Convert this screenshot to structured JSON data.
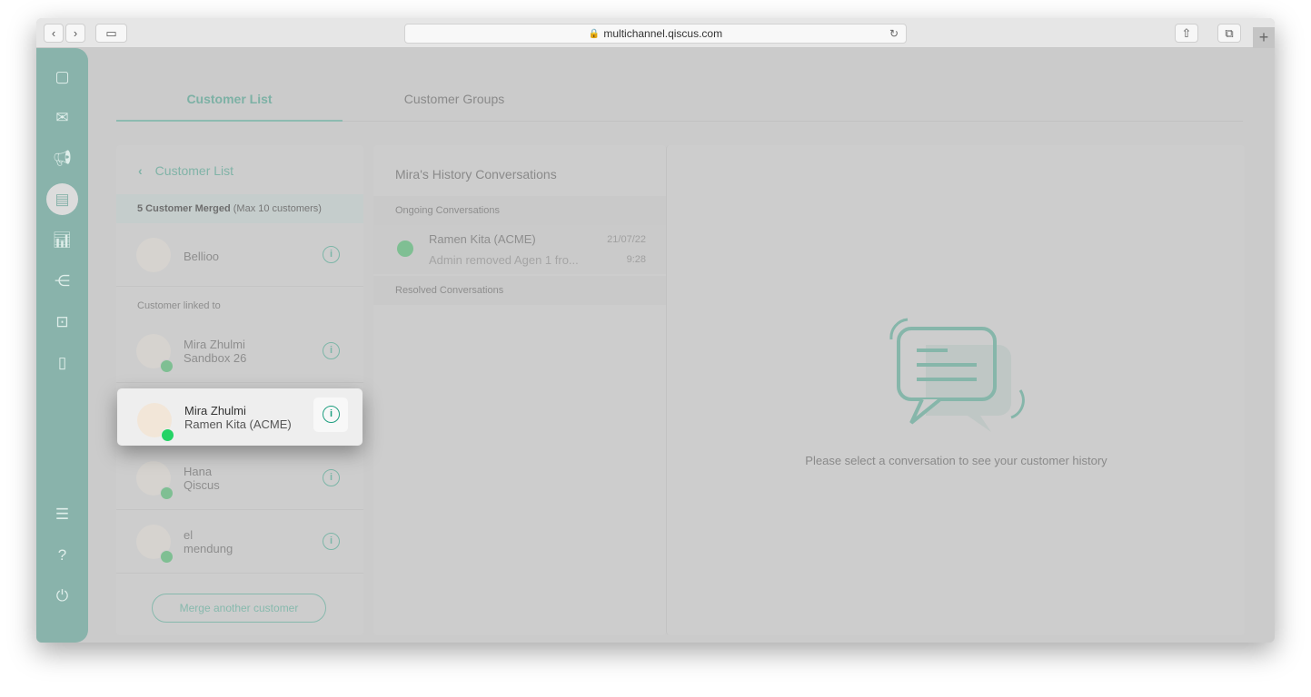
{
  "browser": {
    "url": "multichannel.qiscus.com",
    "new_tab": "+"
  },
  "sidebar": {
    "items": [
      "chat-icon",
      "mail-icon",
      "megaphone-icon",
      "contact-card-icon",
      "analytics-icon",
      "integration-icon",
      "bot-icon",
      "mobile-icon"
    ],
    "bottom": [
      "settings-icon",
      "help-icon",
      "power-icon"
    ],
    "active": "contact-card-icon"
  },
  "tabs": {
    "customer_list": "Customer List",
    "customer_groups": "Customer Groups"
  },
  "left_panel": {
    "back_label": "Customer List",
    "merged_count": "5 Customer Merged",
    "merged_max": "(Max 10 customers)",
    "primary": {
      "name": "Bellioo"
    },
    "linked_label": "Customer linked to",
    "linked": [
      {
        "name": "Mira Zhulmi",
        "channel": "Sandbox 26",
        "channel_type": "whatsapp"
      },
      {
        "name": "Mira Zhulmi",
        "channel": "Ramen Kita (ACME)",
        "channel_type": "whatsapp",
        "highlighted": true
      },
      {
        "name": "Hana",
        "channel": "Qiscus",
        "channel_type": "qiscus"
      },
      {
        "name": "el",
        "channel": "mendung",
        "channel_type": "bot"
      }
    ],
    "merge_button": "Merge another customer"
  },
  "history": {
    "title": "Mira's History Conversations",
    "ongoing_label": "Ongoing Conversations",
    "ongoing": [
      {
        "name": "Ramen Kita (ACME)",
        "date": "21/07/22",
        "preview": "Admin removed Agen 1 fro...",
        "time": "9:28"
      }
    ],
    "resolved_label": "Resolved Conversations"
  },
  "detail": {
    "empty_text": "Please select a conversation to see your customer history"
  },
  "colors": {
    "accent": "#87b9ad",
    "whatsapp": "#25d366"
  }
}
